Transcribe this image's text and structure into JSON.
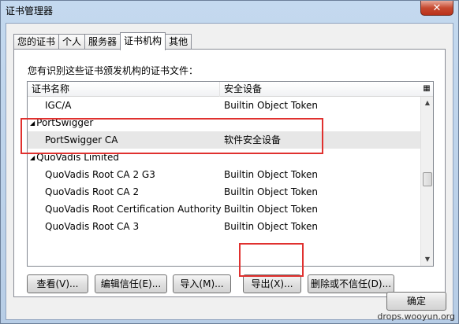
{
  "window": {
    "title": "证书管理器",
    "close_label": "✕"
  },
  "tabs": [
    {
      "label": "您的证书"
    },
    {
      "label": "个人"
    },
    {
      "label": "服务器"
    },
    {
      "label": "证书机构"
    },
    {
      "label": "其他"
    }
  ],
  "active_tab": "证书机构",
  "caption": "您有识别这些证书颁发机构的证书文件：",
  "tree": {
    "columns": [
      "证书名称",
      "安全设备"
    ],
    "rows": [
      {
        "type": "cert",
        "name": "IGC/A",
        "device": "Builtin Object Token"
      },
      {
        "type": "group",
        "name": "PortSwigger",
        "device": ""
      },
      {
        "type": "cert",
        "name": "PortSwigger CA",
        "device": "软件安全设备",
        "selected": true
      },
      {
        "type": "group",
        "name": "QuoVadis Limited",
        "device": ""
      },
      {
        "type": "cert",
        "name": "QuoVadis Root CA 2 G3",
        "device": "Builtin Object Token"
      },
      {
        "type": "cert",
        "name": "QuoVadis Root CA 2",
        "device": "Builtin Object Token"
      },
      {
        "type": "cert",
        "name": "QuoVadis Root Certification Authority",
        "device": "Builtin Object Token"
      },
      {
        "type": "cert",
        "name": "QuoVadis Root CA 3",
        "device": "Builtin Object Token"
      }
    ]
  },
  "buttons": {
    "view": "查看(V)...",
    "edit_trust": "编辑信任(E)...",
    "import": "导入(M)...",
    "export": "导出(X)...",
    "delete": "删除或不信任(D)...",
    "ok": "确定"
  },
  "watermark": "drops.wooyun.org",
  "colors": {
    "highlight_box": "#e0312f"
  }
}
